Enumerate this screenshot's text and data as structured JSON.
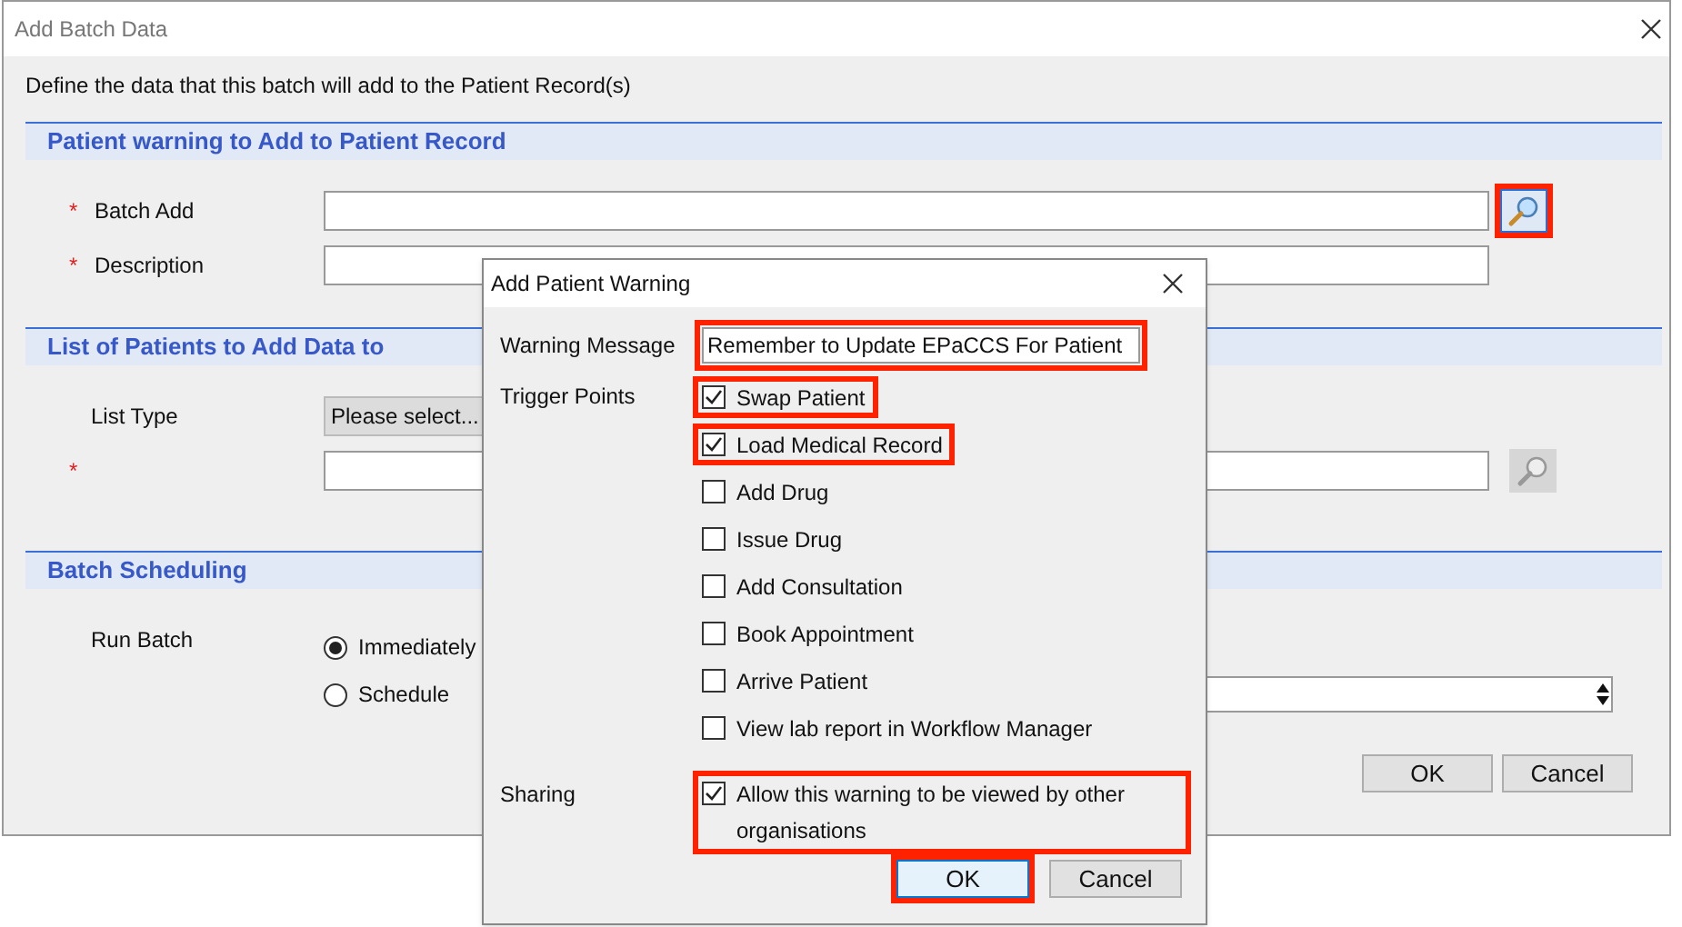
{
  "main_dialog": {
    "title": "Add Batch Data",
    "intro": "Define the data that this batch will add to the Patient Record(s)",
    "sections": [
      {
        "title": "Patient warning to Add to Patient Record",
        "fields": [
          {
            "kind": "lookup",
            "marker": "*",
            "label": "Batch Add",
            "search_disabled": false,
            "highlighted": true
          },
          {
            "kind": "text",
            "marker": "*",
            "label": "Description"
          }
        ]
      },
      {
        "title": "List of Patients to Add Data to",
        "fields": [
          {
            "kind": "select",
            "label": "List Type",
            "value": "Please select..."
          },
          {
            "kind": "lookup",
            "marker": "*",
            "search_disabled": true,
            "highlighted": false
          }
        ]
      },
      {
        "title": "Batch Scheduling",
        "fields": [
          {
            "kind": "radio",
            "label": "Run Batch",
            "options": [
              {
                "label": "Immediately",
                "selected": true,
                "spinner": false
              },
              {
                "label": "Schedule",
                "selected": false,
                "spinner": true
              }
            ]
          }
        ]
      }
    ],
    "buttons": [
      {
        "label": "OK"
      },
      {
        "label": "Cancel"
      }
    ]
  },
  "modal": {
    "title": "Add Patient Warning",
    "warning_message": {
      "label": "Warning Message",
      "value": "Remember to Update EPaCCS For Patient",
      "highlighted": true
    },
    "trigger_points": {
      "label": "Trigger Points",
      "items": [
        {
          "label": "Swap Patient",
          "checked": true,
          "highlighted": true
        },
        {
          "label": "Load Medical Record",
          "checked": true,
          "highlighted": true
        },
        {
          "label": "Add Drug",
          "checked": false,
          "highlighted": false
        },
        {
          "label": "Issue Drug",
          "checked": false,
          "highlighted": false
        },
        {
          "label": "Add Consultation",
          "checked": false,
          "highlighted": false
        },
        {
          "label": "Book Appointment",
          "checked": false,
          "highlighted": false
        },
        {
          "label": "Arrive Patient",
          "checked": false,
          "highlighted": false
        },
        {
          "label": "View lab report in Workflow Manager",
          "checked": false,
          "highlighted": false
        }
      ]
    },
    "sharing": {
      "label": "Sharing",
      "option": {
        "label": "Allow this warning to be viewed by other organisations",
        "checked": true,
        "highlighted": true
      }
    },
    "buttons": [
      {
        "label": "OK",
        "default": true,
        "highlighted": true
      },
      {
        "label": "Cancel",
        "default": false,
        "highlighted": false
      }
    ]
  }
}
